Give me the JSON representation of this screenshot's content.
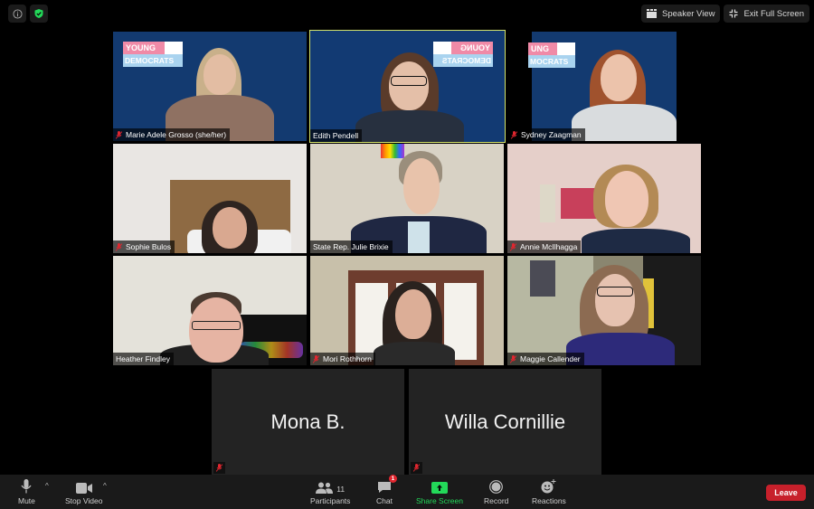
{
  "top_bar": {
    "info_icon": "info-icon",
    "security_icon": "shield-check-icon",
    "speaker_view_label": "Speaker View",
    "exit_full_screen_label": "Exit Full Screen"
  },
  "logo": {
    "top": "YOUNG",
    "bottom": "DEMOCRATS"
  },
  "participants_grid": [
    {
      "name": "Marie Adele Grosso (she/her)",
      "muted": true,
      "active_speaker": false,
      "video": true
    },
    {
      "name": "Edith Pendell",
      "muted": false,
      "active_speaker": true,
      "video": true
    },
    {
      "name": "Sydney Zaagman",
      "muted": true,
      "active_speaker": false,
      "video": true
    },
    {
      "name": "Sophie Bulos",
      "muted": true,
      "active_speaker": false,
      "video": true
    },
    {
      "name": "State Rep. Julie Brixie",
      "muted": false,
      "active_speaker": false,
      "video": true
    },
    {
      "name": "Annie McIlhagga",
      "muted": true,
      "active_speaker": false,
      "video": true
    },
    {
      "name": "Heather Findley",
      "muted": false,
      "active_speaker": false,
      "video": true
    },
    {
      "name": "Mori Rothhorn",
      "muted": true,
      "active_speaker": false,
      "video": true
    },
    {
      "name": "Maggie Callender",
      "muted": true,
      "active_speaker": false,
      "video": true
    },
    {
      "name": "Mona B.",
      "muted": true,
      "active_speaker": false,
      "video": false
    },
    {
      "name": "Willa Cornillie",
      "muted": true,
      "active_speaker": false,
      "video": false
    }
  ],
  "toolbar": {
    "mute_label": "Mute",
    "stop_video_label": "Stop Video",
    "participants_label": "Participants",
    "participants_count": "11",
    "chat_label": "Chat",
    "chat_badge": "1",
    "share_screen_label": "Share Screen",
    "record_label": "Record",
    "reactions_label": "Reactions",
    "leave_label": "Leave"
  },
  "colors": {
    "active_speaker_border": "#d4e36a",
    "share_green": "#23d959",
    "leave_red": "#c7202b",
    "muted_red": "#e0262f",
    "backdrop_blue": "#123a73"
  }
}
